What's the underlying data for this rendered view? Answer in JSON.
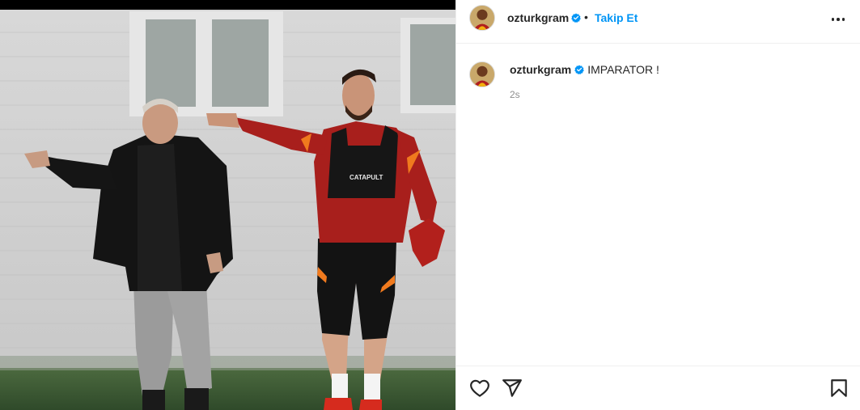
{
  "post": {
    "username": "ozturkgram",
    "verified": true,
    "separator": "•",
    "follow_label": "Takip Et",
    "caption": "IMPARATOR !",
    "timestamp": "2s"
  },
  "photo": {
    "subject": "football training photo",
    "vest_label": "CATAPULT"
  },
  "icons": {
    "like": "heart-icon",
    "share": "paper-plane-icon",
    "save": "bookmark-icon",
    "more": "more-options-icon",
    "verified": "verified-badge-icon"
  },
  "colors": {
    "follow_blue": "#0095f6",
    "verified_blue": "#0095f6",
    "text": "#262626",
    "muted": "#8e8e8e",
    "border": "#efefef"
  }
}
